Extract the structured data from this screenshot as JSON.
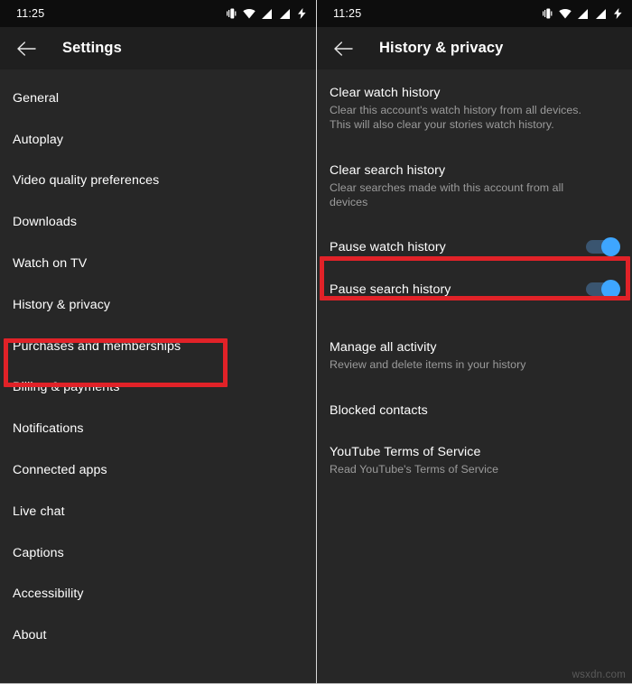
{
  "status_bar": {
    "time": "11:25",
    "icons": [
      "vibrate-icon",
      "wifi-icon",
      "signal-bars-icon",
      "signal-bars-x-icon",
      "charging-bolt-icon"
    ]
  },
  "colors": {
    "background": "#272727",
    "app_bar": "#1f1f1f",
    "status_bar": "#0d0d0d",
    "annotation_red": "#e12228",
    "toggle_thumb_on": "#3ea6ff",
    "toggle_track_on": "#3a5570",
    "primary_text": "#ffffff",
    "secondary_text": "#9b9b9b"
  },
  "left_screen": {
    "app_bar": {
      "back_label": "back-arrow",
      "title": "Settings"
    },
    "nav_items": [
      {
        "label": "General",
        "highlighted": false
      },
      {
        "label": "Autoplay",
        "highlighted": false
      },
      {
        "label": "Video quality preferences",
        "highlighted": false
      },
      {
        "label": "Downloads",
        "highlighted": false
      },
      {
        "label": "Watch on TV",
        "highlighted": false
      },
      {
        "label": "History & privacy",
        "highlighted": true
      },
      {
        "label": "Purchases and memberships",
        "highlighted": false
      },
      {
        "label": "Billing & payments",
        "highlighted": false
      },
      {
        "label": "Notifications",
        "highlighted": false
      },
      {
        "label": "Connected apps",
        "highlighted": false
      },
      {
        "label": "Live chat",
        "highlighted": false
      },
      {
        "label": "Captions",
        "highlighted": false
      },
      {
        "label": "Accessibility",
        "highlighted": false
      },
      {
        "label": "About",
        "highlighted": false
      }
    ]
  },
  "right_screen": {
    "app_bar": {
      "back_label": "back-arrow",
      "title": "History & privacy"
    },
    "settings": [
      {
        "title": "Clear watch history",
        "subtitle": "Clear this account's watch history from all devices. This will also clear your stories watch history.",
        "type": "action"
      },
      {
        "title": "Clear search history",
        "subtitle": "Clear searches made with this account from all devices",
        "type": "action"
      },
      {
        "title": "Pause watch history",
        "subtitle": "",
        "type": "toggle",
        "toggle_state": "on",
        "highlighted": true
      },
      {
        "title": "Pause search history",
        "subtitle": "",
        "type": "toggle",
        "toggle_state": "on",
        "highlighted": false
      },
      {
        "title": "Manage all activity",
        "subtitle": "Review and delete items in your history",
        "type": "action"
      },
      {
        "title": "Blocked contacts",
        "subtitle": "",
        "type": "action"
      },
      {
        "title": "YouTube Terms of Service",
        "subtitle": "Read YouTube's Terms of Service",
        "type": "action"
      }
    ]
  },
  "watermark": "wsxdn.com"
}
